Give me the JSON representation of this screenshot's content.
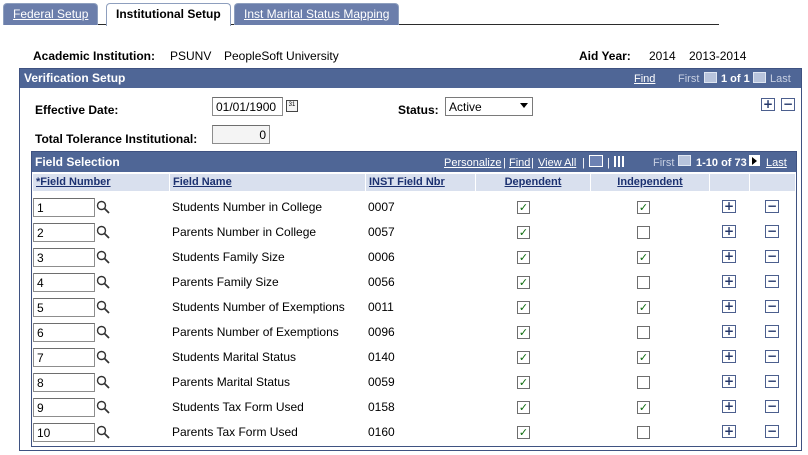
{
  "tabs": [
    {
      "label": "Federal Setup",
      "active": false
    },
    {
      "label": "Institutional Setup",
      "active": true
    },
    {
      "label": "Inst Marital Status Mapping",
      "active": false
    }
  ],
  "header": {
    "academic_institution_label": "Academic Institution:",
    "institution_code": "PSUNV",
    "institution_name": "PeopleSoft University",
    "aid_year_label": "Aid Year:",
    "aid_year": "2014",
    "aid_year_desc": "2013-2014"
  },
  "verification": {
    "title": "Verification Setup",
    "find": "Find",
    "first": "First",
    "count": "1 of 1",
    "last": "Last",
    "effective_date_label": "Effective Date:",
    "effective_date": "01/01/1900",
    "status_label": "Status:",
    "status": "Active",
    "tolerance_label": "Total Tolerance Institutional:",
    "tolerance": "0",
    "add_symbol": "+",
    "remove_symbol": "−"
  },
  "field_selection": {
    "title": "Field Selection",
    "personalize": "Personalize",
    "sep": "|",
    "find": "Find",
    "view_all": "View All",
    "first": "First",
    "range": "1-10 of 73",
    "last": "Last",
    "columns": {
      "field_number": "*Field Number",
      "field_name": "Field Name",
      "inst_field_nbr": "INST Field Nbr",
      "dependent": "Dependent",
      "independent": "Independent"
    },
    "rows": [
      {
        "num": "1",
        "name": "Students Number in College",
        "inst": "0007",
        "dependent": true,
        "independent": true
      },
      {
        "num": "2",
        "name": "Parents Number in College",
        "inst": "0057",
        "dependent": true,
        "independent": false
      },
      {
        "num": "3",
        "name": "Students Family Size",
        "inst": "0006",
        "dependent": true,
        "independent": true
      },
      {
        "num": "4",
        "name": "Parents Family Size",
        "inst": "0056",
        "dependent": true,
        "independent": false
      },
      {
        "num": "5",
        "name": "Students Number of Exemptions",
        "inst": "0011",
        "dependent": true,
        "independent": true
      },
      {
        "num": "6",
        "name": "Parents Number of Exemptions",
        "inst": "0096",
        "dependent": true,
        "independent": false
      },
      {
        "num": "7",
        "name": "Students Marital Status",
        "inst": "0140",
        "dependent": true,
        "independent": true
      },
      {
        "num": "8",
        "name": "Parents Marital Status",
        "inst": "0059",
        "dependent": true,
        "independent": false
      },
      {
        "num": "9",
        "name": "Students Tax Form Used",
        "inst": "0158",
        "dependent": true,
        "independent": true
      },
      {
        "num": "10",
        "name": "Parents Tax Form Used",
        "inst": "0160",
        "dependent": true,
        "independent": false
      }
    ]
  },
  "colors": {
    "header_bar": "#4f6696",
    "col_header": "#d9e0ee",
    "tab_inactive": "#6b7eab"
  }
}
